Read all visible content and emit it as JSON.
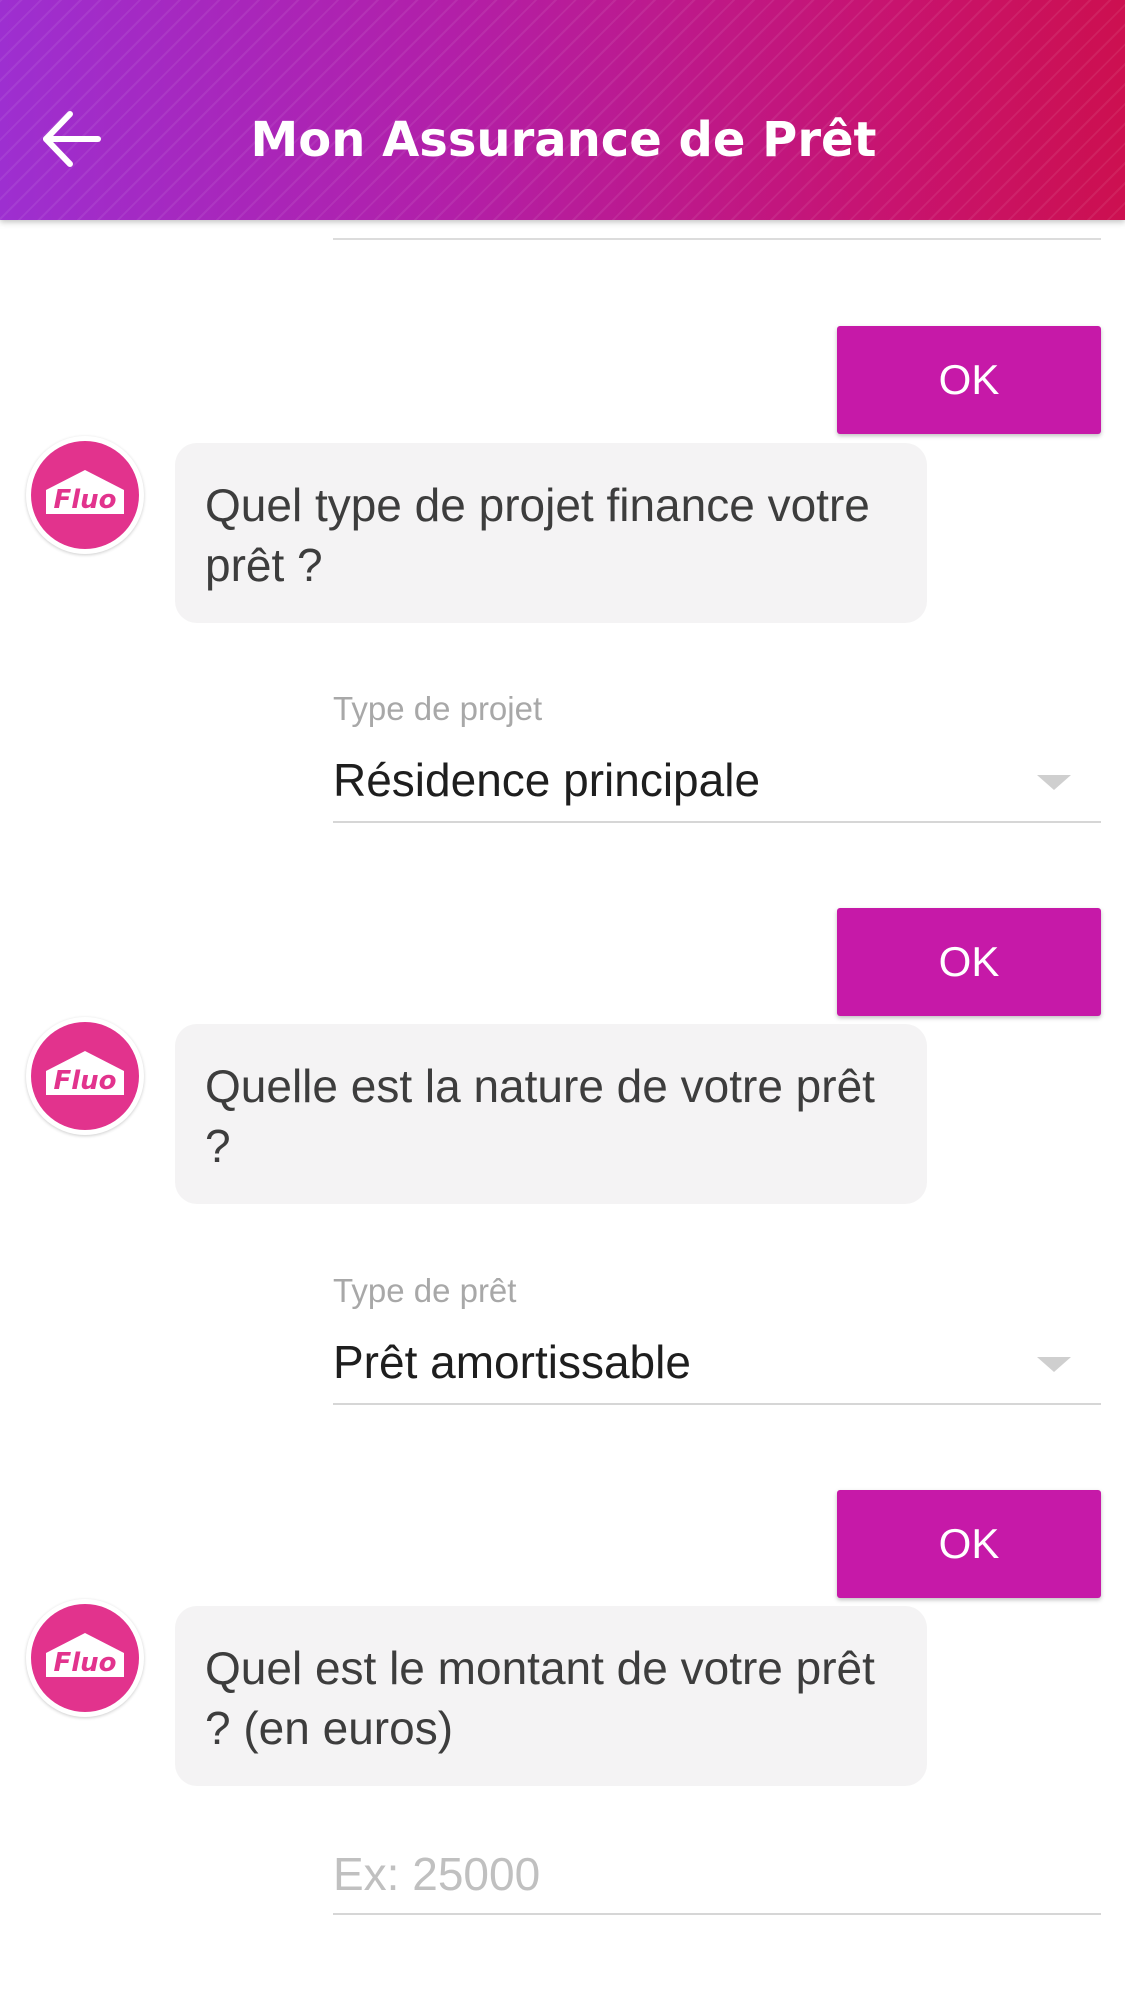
{
  "header": {
    "title": "Mon Assurance de Prêt",
    "back_icon": "arrow-left-icon",
    "gradient": [
      "#9d2fd0",
      "#cc1050"
    ]
  },
  "accent_color": "#c619a8",
  "avatar": {
    "logo_text": "Fluo",
    "icon": "fluo-logo-icon",
    "color": "#e2338d"
  },
  "conversation": {
    "ok_label": "OK",
    "questions": [
      {
        "text": "Quel type de projet finance votre prêt ?"
      },
      {
        "text": "Quelle est la nature de votre prêt ?"
      },
      {
        "text": "Quel est le montant de votre prêt ? (en euros)"
      }
    ],
    "project_type": {
      "label": "Type de projet",
      "value": "Résidence principale"
    },
    "loan_type": {
      "label": "Type de prêt",
      "value": "Prêt amortissable"
    },
    "amount_input": {
      "placeholder": "Ex: 25000",
      "value": ""
    }
  }
}
